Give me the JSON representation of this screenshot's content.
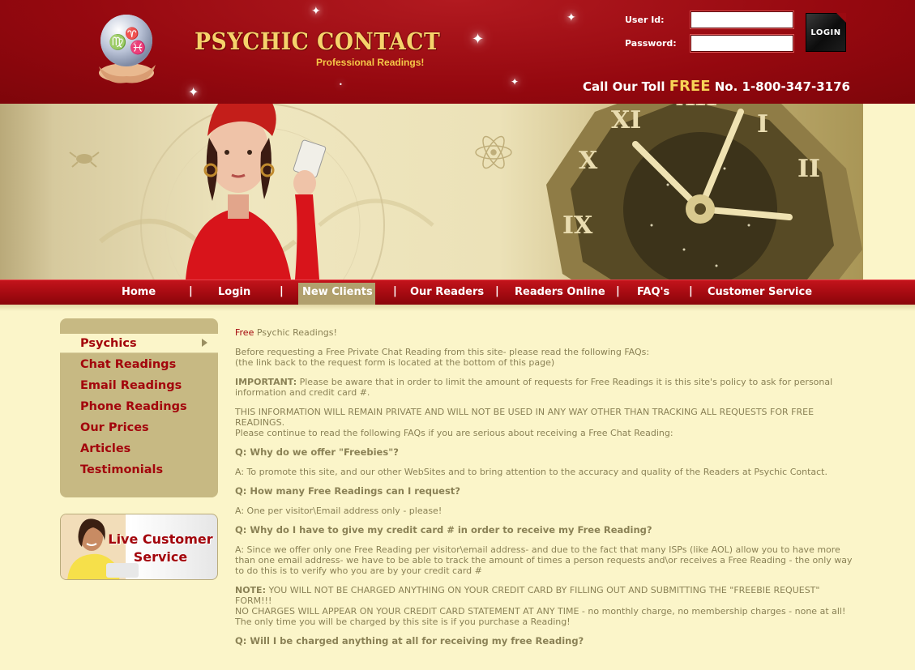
{
  "header": {
    "logo_title": "PSYCHIC CONTACT",
    "logo_subtitle": "Professional Readings!",
    "user_id_label": "User Id:",
    "password_label": "Password:",
    "user_id_value": "",
    "password_value": "",
    "login_button": "LOGIN",
    "toll_prefix": "Call Our Toll ",
    "toll_free": "FREE",
    "toll_suffix": " No. 1-800-347-3176"
  },
  "nav": {
    "items": [
      "Home",
      "Login",
      "New Clients",
      "Our Readers",
      "Readers Online",
      "FAQ's",
      "Customer Service"
    ],
    "separator": "|",
    "active": "New Clients"
  },
  "sidebar": {
    "items": [
      "Psychics",
      "Chat Readings",
      "Email Readings",
      "Phone Readings",
      "Our Prices",
      "Articles",
      "Testimonials"
    ],
    "active": "Psychics",
    "live_service_line1": "Live Customer",
    "live_service_line2": "Service"
  },
  "content": {
    "title_red": "Free",
    "title_rest": " Psychic Readings!",
    "intro_line1": "Before requesting a Free Private Chat Reading from this site- please read the following FAQs:",
    "intro_line2": "(the link back to the request form is located at the bottom of this page)",
    "important_label": "IMPORTANT:",
    "important_text": " Please be aware that in order to limit the amount of requests for Free Readings it is this site's policy to ask for personal information and credit card #.",
    "info_caps": "THIS INFORMATION WILL REMAIN PRIVATE AND WILL NOT BE USED IN ANY WAY OTHER THAN TRACKING ALL REQUESTS FOR FREE READINGS.",
    "info_continue": "Please continue to read the following FAQs if you are serious about receiving a Free Chat Reading:",
    "q1": "Q: Why do we offer \"Freebies\"?",
    "a1": "A: To promote this site, and our other WebSites and to bring attention to the accuracy and quality of the Readers at Psychic Contact.",
    "q2": "Q: How many Free Readings can I request?",
    "a2": "A: One per visitor\\Email address only - please!",
    "q3": "Q: Why do I have to give my credit card # in order to receive my Free Reading?",
    "a3": "A: Since we offer only one Free Reading per visitor\\email address- and due to the fact that many ISPs (like AOL) allow you to have more than one email address- we have to be able to track the amount of times a person requests and\\or receives a Free Reading - the only way to do this is to verify who you are by your credit card #",
    "note_label": "NOTE:",
    "note_text": " YOU WILL NOT BE CHARGED ANYTHING ON YOUR CREDIT CARD BY FILLING OUT AND SUBMITTING THE \"FREEBIE REQUEST\" FORM!!!",
    "note_line2": "NO CHARGES WILL APPEAR ON YOUR CREDIT CARD STATEMENT AT ANY TIME - no monthly charge, no membership charges - none at all!",
    "note_line3": "The only time you will be charged by this site is if you purchase a Reading!",
    "q4": "Q: Will I be charged anything at all for receiving my free Reading?"
  },
  "colors": {
    "header_red": "#9c0a11",
    "nav_red": "#b10f16",
    "gold": "#f6d36b",
    "page_bg": "#fbf5c9",
    "sidebar_bg": "#c7b983",
    "link_red": "#a3050c",
    "text": "#8a8155"
  }
}
